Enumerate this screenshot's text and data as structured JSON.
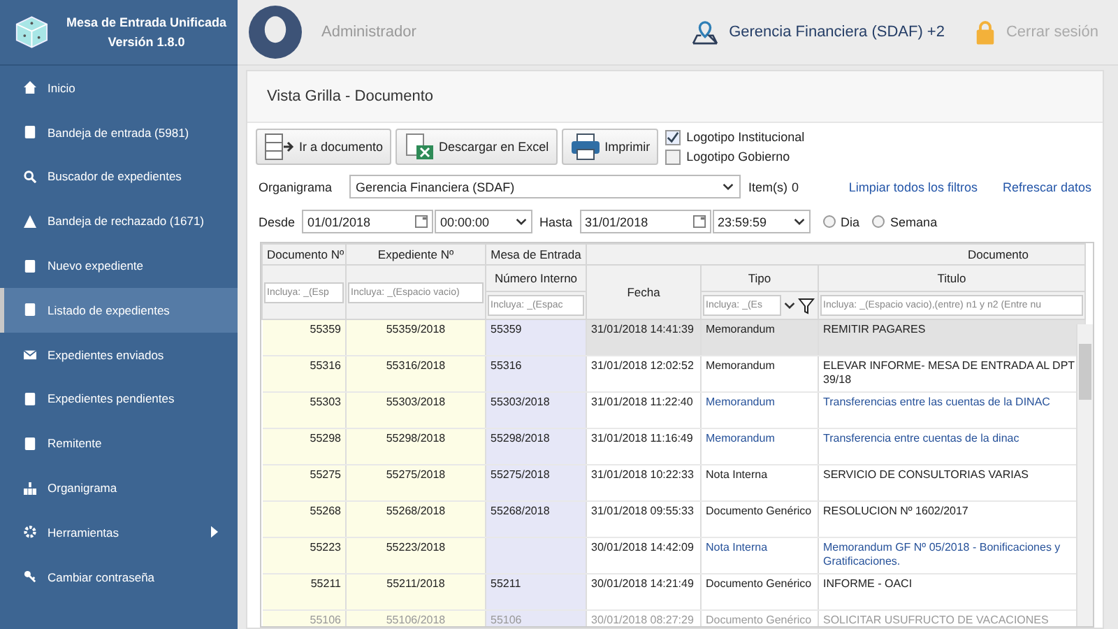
{
  "app": {
    "title": "Mesa de Entrada Unificada",
    "version": "Versión 1.8.0"
  },
  "sidebar": {
    "items": [
      {
        "label": "Inicio",
        "selected": false,
        "submenu": false
      },
      {
        "label": "Bandeja de entrada (5981)",
        "selected": false,
        "submenu": false
      },
      {
        "label": "Buscador de expedientes",
        "selected": false,
        "submenu": false
      },
      {
        "label": "Bandeja de rechazado (1671)",
        "selected": false,
        "submenu": false
      },
      {
        "label": "Nuevo expediente",
        "selected": false,
        "submenu": false
      },
      {
        "label": "Listado de expedientes",
        "selected": true,
        "submenu": false
      },
      {
        "label": "Expedientes enviados",
        "selected": false,
        "submenu": false
      },
      {
        "label": "Expedientes pendientes",
        "selected": false,
        "submenu": false
      },
      {
        "label": "Remitente",
        "selected": false,
        "submenu": false
      },
      {
        "label": "Organigrama",
        "selected": false,
        "submenu": false
      },
      {
        "label": "Herramientas",
        "selected": false,
        "submenu": true
      },
      {
        "label": "Cambiar contraseña",
        "selected": false,
        "submenu": false
      }
    ]
  },
  "topbar": {
    "user": "Administrador",
    "office": "Gerencia Financiera (SDAF) +2",
    "logout": "Cerrar sesión"
  },
  "panel": {
    "title": "Vista Grilla - Documento"
  },
  "toolbar": {
    "buttons": [
      "Ir a documento",
      "Descargar en Excel",
      "Imprimir"
    ],
    "checkboxes": [
      {
        "label": "Logotipo Institucional",
        "checked": true
      },
      {
        "label": "Logotipo Gobierno",
        "checked": false
      }
    ]
  },
  "filters": {
    "organigrama_label": "Organigrama",
    "organigrama_value": "Gerencia Financiera (SDAF)",
    "items_label": "Item(s)",
    "items_count": "0",
    "links": [
      "Limpiar todos los filtros",
      "Refrescar datos"
    ],
    "desde_label": "Desde",
    "desde_date": "01/01/2018",
    "desde_time": "00:00:00",
    "hasta_label": "Hasta",
    "hasta_date": "31/01/2018",
    "hasta_time": "23:59:59",
    "radios": [
      {
        "label": "Dia",
        "selected": false
      },
      {
        "label": "Semana",
        "selected": false
      }
    ]
  },
  "table": {
    "headers": {
      "documento": "Documento Nº",
      "expediente": "Expediente Nº",
      "mesa": "Mesa de Entrada",
      "numero_interno": "Número Interno",
      "fecha": "Fecha",
      "group": "Documento",
      "tipo": "Tipo",
      "titulo": "Titulo"
    },
    "filter_fields": {
      "documento": {
        "placeholder": "Incluya: _(Esp"
      },
      "expediente": {
        "placeholder": "Incluya: _(Espacio vacio)"
      },
      "numero_interno": {
        "placeholder": "Incluya: _(Espac"
      },
      "tipo": {
        "placeholder": "Incluya: _(Es"
      },
      "titulo": {
        "placeholder": "Incluya: _(Espacio vacio),(entre) n1 y n2 (Entre nu"
      }
    },
    "rows": [
      {
        "documento": "55359",
        "expediente": "55359/2018",
        "numero_interno": "55359",
        "fecha": "31/01/2018 14:41:39",
        "tipo": "Memorandum",
        "titulo": "REMITIR PAGARES",
        "selected": true,
        "highlighted": false,
        "dimmed": false
      },
      {
        "documento": "55316",
        "expediente": "55316/2018",
        "numero_interno": "55316",
        "fecha": "31/01/2018 12:02:52",
        "tipo": "Memorandum",
        "titulo": "ELEVAR INFORME- MESA DE ENTRADA AL DPT 39/18",
        "selected": false,
        "highlighted": false,
        "dimmed": false
      },
      {
        "documento": "55303",
        "expediente": "55303/2018",
        "numero_interno": "55303/2018",
        "fecha": "31/01/2018 11:22:40",
        "tipo": "Memorandum",
        "titulo": "Transferencias entre las cuentas de la DINAC",
        "selected": false,
        "highlighted": true,
        "dimmed": false
      },
      {
        "documento": "55298",
        "expediente": "55298/2018",
        "numero_interno": "55298/2018",
        "fecha": "31/01/2018 11:16:49",
        "tipo": "Memorandum",
        "titulo": "Transferencia entre cuentas de la dinac",
        "selected": false,
        "highlighted": true,
        "dimmed": false
      },
      {
        "documento": "55275",
        "expediente": "55275/2018",
        "numero_interno": "55275/2018",
        "fecha": "31/01/2018 10:22:33",
        "tipo": "Nota Interna",
        "titulo": "SERVICIO DE CONSULTORIAS VARIAS",
        "selected": false,
        "highlighted": false,
        "dimmed": false
      },
      {
        "documento": "55268",
        "expediente": "55268/2018",
        "numero_interno": "55268/2018",
        "fecha": "31/01/2018 09:55:33",
        "tipo": "Documento Genérico",
        "titulo": "RESOLUCION Nº 1602/2017",
        "selected": false,
        "highlighted": false,
        "dimmed": false
      },
      {
        "documento": "55223",
        "expediente": "55223/2018",
        "fecha": "30/01/2018 14:42:09",
        "tipo": "Nota Interna",
        "titulo": "Memorandum GF Nº 05/2018 - Bonificaciones y Gratificaciones.",
        "selected": false,
        "highlighted": true,
        "dimmed": false
      },
      {
        "documento": "55211",
        "expediente": "55211/2018",
        "numero_interno": "55211",
        "fecha": "30/01/2018 14:21:49",
        "tipo": "Documento Genérico",
        "titulo": "INFORME - OACI",
        "selected": false,
        "highlighted": false,
        "dimmed": false
      },
      {
        "documento": "55106",
        "expediente": "55106/2018",
        "numero_interno": "55106",
        "fecha": "30/01/2018 08:27:29",
        "tipo": "Documento Genérico",
        "titulo": "SOLICITAR USUFRUCTO DE VACACIONES",
        "selected": false,
        "highlighted": false,
        "dimmed": true
      }
    ]
  }
}
